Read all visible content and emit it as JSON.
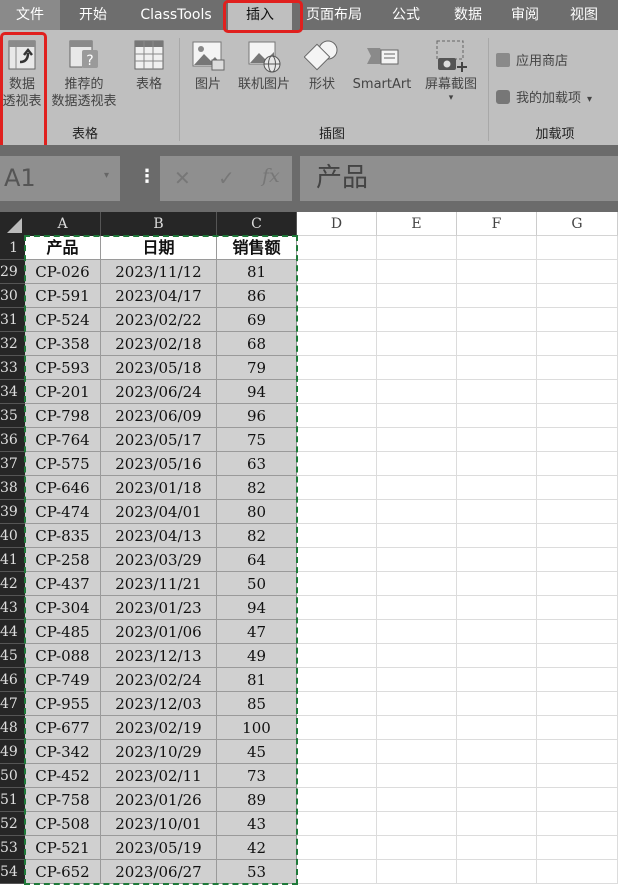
{
  "tabs": [
    "文件",
    "开始",
    "ClassTools",
    "插入",
    "页面布局",
    "公式",
    "数据",
    "审阅",
    "视图"
  ],
  "ribbon": {
    "pivot_table": [
      "数据",
      "透视表"
    ],
    "recommended_pivot": [
      "推荐的",
      "数据透视表"
    ],
    "table": "表格",
    "picture": "图片",
    "online_picture": "联机图片",
    "shapes": "形状",
    "smartart": "SmartArt",
    "screenshot": "屏幕截图",
    "app_store": "应用商店",
    "my_addins": "我的加载项",
    "groups": {
      "tables": "表格",
      "illustrations": "插图",
      "addins": "加载项"
    }
  },
  "formula_bar": {
    "name_box": "A1",
    "content": "产品"
  },
  "sheet": {
    "columns": [
      "A",
      "B",
      "C",
      "D",
      "E",
      "F",
      "G"
    ],
    "header_row_number": "1",
    "headers": [
      "产品",
      "日期",
      "销售额"
    ],
    "rows": [
      {
        "n": "29",
        "a": "CP-026",
        "b": "2023/11/12",
        "c": "81"
      },
      {
        "n": "30",
        "a": "CP-591",
        "b": "2023/04/17",
        "c": "86"
      },
      {
        "n": "31",
        "a": "CP-524",
        "b": "2023/02/22",
        "c": "69"
      },
      {
        "n": "32",
        "a": "CP-358",
        "b": "2023/02/18",
        "c": "68"
      },
      {
        "n": "33",
        "a": "CP-593",
        "b": "2023/05/18",
        "c": "79"
      },
      {
        "n": "34",
        "a": "CP-201",
        "b": "2023/06/24",
        "c": "94"
      },
      {
        "n": "35",
        "a": "CP-798",
        "b": "2023/06/09",
        "c": "96"
      },
      {
        "n": "36",
        "a": "CP-764",
        "b": "2023/05/17",
        "c": "75"
      },
      {
        "n": "37",
        "a": "CP-575",
        "b": "2023/05/16",
        "c": "63"
      },
      {
        "n": "38",
        "a": "CP-646",
        "b": "2023/01/18",
        "c": "82"
      },
      {
        "n": "39",
        "a": "CP-474",
        "b": "2023/04/01",
        "c": "80"
      },
      {
        "n": "40",
        "a": "CP-835",
        "b": "2023/04/13",
        "c": "82"
      },
      {
        "n": "41",
        "a": "CP-258",
        "b": "2023/03/29",
        "c": "64"
      },
      {
        "n": "42",
        "a": "CP-437",
        "b": "2023/11/21",
        "c": "50"
      },
      {
        "n": "43",
        "a": "CP-304",
        "b": "2023/01/23",
        "c": "94"
      },
      {
        "n": "44",
        "a": "CP-485",
        "b": "2023/01/06",
        "c": "47"
      },
      {
        "n": "45",
        "a": "CP-088",
        "b": "2023/12/13",
        "c": "49"
      },
      {
        "n": "46",
        "a": "CP-749",
        "b": "2023/02/24",
        "c": "81"
      },
      {
        "n": "47",
        "a": "CP-955",
        "b": "2023/12/03",
        "c": "85"
      },
      {
        "n": "48",
        "a": "CP-677",
        "b": "2023/02/19",
        "c": "100"
      },
      {
        "n": "49",
        "a": "CP-342",
        "b": "2023/10/29",
        "c": "45"
      },
      {
        "n": "50",
        "a": "CP-452",
        "b": "2023/02/11",
        "c": "73"
      },
      {
        "n": "51",
        "a": "CP-758",
        "b": "2023/01/26",
        "c": "89"
      },
      {
        "n": "52",
        "a": "CP-508",
        "b": "2023/10/01",
        "c": "43"
      },
      {
        "n": "53",
        "a": "CP-521",
        "b": "2023/05/19",
        "c": "42"
      },
      {
        "n": "54",
        "a": "CP-652",
        "b": "2023/06/27",
        "c": "53"
      }
    ]
  },
  "colors": {
    "highlight": "#e0201e",
    "selection_border": "#1f7a3a",
    "ribbon": "#bfbfbf",
    "tabbar": "#6e6e6e"
  }
}
